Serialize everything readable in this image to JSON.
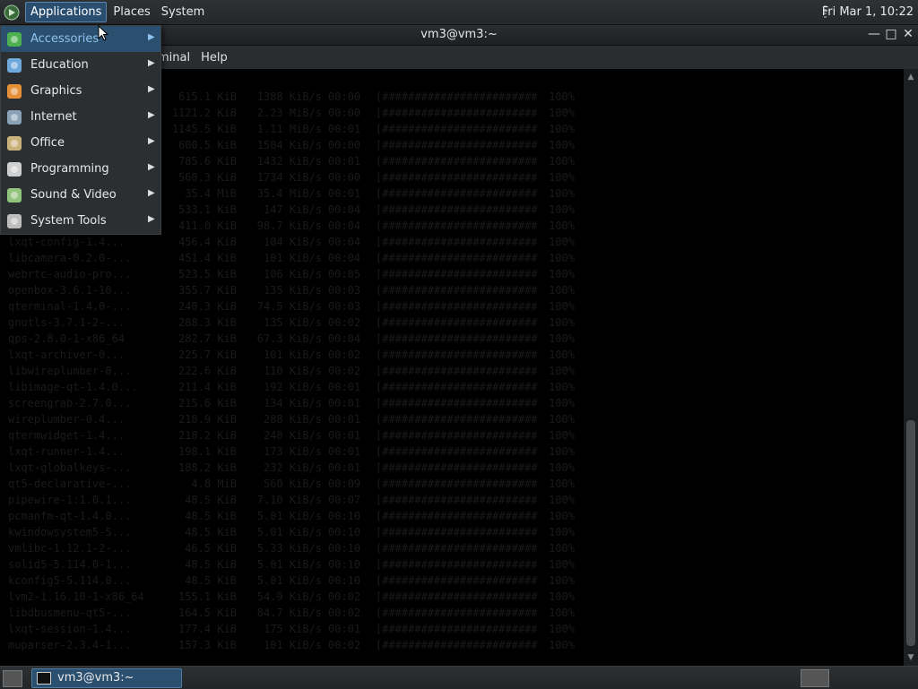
{
  "top_panel": {
    "menus": [
      "Applications",
      "Places",
      "System"
    ],
    "clock": "Fri Mar 1, 10:22"
  },
  "terminal": {
    "title": "vm3@vm3:~",
    "menus": [
      "minal",
      "Help"
    ],
    "lines": [
      {
        "name": "",
        "size": "615.1 KiB",
        "speed": "1388 KiB/s",
        "time": "00:00",
        "pct": "100%"
      },
      {
        "name": "",
        "size": "1121.2 KiB",
        "speed": "2.23 MiB/s",
        "time": "00:00",
        "pct": "100%"
      },
      {
        "name": "",
        "size": "1145.5 KiB",
        "speed": "1.11 MiB/s",
        "time": "00:01",
        "pct": "100%"
      },
      {
        "name": "",
        "size": "600.5 KiB",
        "speed": "1504 KiB/s",
        "time": "00:00",
        "pct": "100%"
      },
      {
        "name": "",
        "size": "785.6 KiB",
        "speed": "1432 KiB/s",
        "time": "00:01",
        "pct": "100%"
      },
      {
        "name": "",
        "size": "560.3 KiB",
        "speed": "1734 KiB/s",
        "time": "00:00",
        "pct": "100%"
      },
      {
        "name": "",
        "size": "35.4 MiB",
        "speed": "35.4 MiB/s",
        "time": "00:01",
        "pct": "100%"
      },
      {
        "name": "",
        "size": "533.1 KiB",
        "speed": "147 KiB/s",
        "time": "00:04",
        "pct": "100%"
      },
      {
        "name": "",
        "size": "411.0 KiB",
        "speed": "98.7 KiB/s",
        "time": "00:04",
        "pct": "100%"
      },
      {
        "name": "lxqt-config-1.4...",
        "size": "456.4 KiB",
        "speed": "104 KiB/s",
        "time": "00:04",
        "pct": "100%"
      },
      {
        "name": "libcamera-0.2.0-...",
        "size": "451.4 KiB",
        "speed": "101 KiB/s",
        "time": "00:04",
        "pct": "100%"
      },
      {
        "name": "webrtc-audio-pro...",
        "size": "523.5 KiB",
        "speed": "106 KiB/s",
        "time": "00:05",
        "pct": "100%"
      },
      {
        "name": "openbox-3.6.1-10...",
        "size": "355.7 KiB",
        "speed": "135 KiB/s",
        "time": "00:03",
        "pct": "100%"
      },
      {
        "name": "qterminal-1.4.0-...",
        "size": "240.3 KiB",
        "speed": "74.5 KiB/s",
        "time": "00:03",
        "pct": "100%"
      },
      {
        "name": "gnutls-3.7.1-2-...",
        "size": "288.3 KiB",
        "speed": "135 KiB/s",
        "time": "00:02",
        "pct": "100%"
      },
      {
        "name": "qps-2.8.0-1-x86_64",
        "size": "282.7 KiB",
        "speed": "67.3 KiB/s",
        "time": "00:04",
        "pct": "100%"
      },
      {
        "name": "lxqt-archiver-0...",
        "size": "225.7 KiB",
        "speed": "101 KiB/s",
        "time": "00:02",
        "pct": "100%"
      },
      {
        "name": "libwireplumber-0...",
        "size": "222.6 KiB",
        "speed": "110 KiB/s",
        "time": "00:02",
        "pct": "100%"
      },
      {
        "name": "libimage-qt-1.4.0...",
        "size": "211.4 KiB",
        "speed": "192 KiB/s",
        "time": "00:01",
        "pct": "100%"
      },
      {
        "name": "screengrab-2.7.0...",
        "size": "215.6 KiB",
        "speed": "134 KiB/s",
        "time": "00:01",
        "pct": "100%"
      },
      {
        "name": "wireplumber-0.4...",
        "size": "218.9 KiB",
        "speed": "288 KiB/s",
        "time": "00:01",
        "pct": "100%"
      },
      {
        "name": "qtermwidget-1.4...",
        "size": "218.2 KiB",
        "speed": "248 KiB/s",
        "time": "00:01",
        "pct": "100%"
      },
      {
        "name": "lxqt-runner-1.4...",
        "size": "198.1 KiB",
        "speed": "173 KiB/s",
        "time": "00:01",
        "pct": "100%"
      },
      {
        "name": "lxqt-globalkeys-...",
        "size": "188.2 KiB",
        "speed": "232 KiB/s",
        "time": "00:01",
        "pct": "100%"
      },
      {
        "name": "qt5-declarative-...",
        "size": "4.8 MiB",
        "speed": "560 KiB/s",
        "time": "00:09",
        "pct": "100%"
      },
      {
        "name": "pipewire-1:1.0.1...",
        "size": "48.5 KiB",
        "speed": "7.10 KiB/s",
        "time": "00:07",
        "pct": "100%"
      },
      {
        "name": "pcmanfm-qt-1.4.0...",
        "size": "48.5 KiB",
        "speed": "5.01 KiB/s",
        "time": "00:10",
        "pct": "100%"
      },
      {
        "name": "kwindowsystem5-5...",
        "size": "48.5 KiB",
        "speed": "5.01 KiB/s",
        "time": "00:10",
        "pct": "100%"
      },
      {
        "name": "vmlibc-1.12.1-2-...",
        "size": "46.5 KiB",
        "speed": "5.33 KiB/s",
        "time": "00:10",
        "pct": "100%"
      },
      {
        "name": "solid5-5.114.0-1...",
        "size": "48.5 KiB",
        "speed": "5.01 KiB/s",
        "time": "00:10",
        "pct": "100%"
      },
      {
        "name": "kconfig5-5.114.0...",
        "size": "48.5 KiB",
        "speed": "5.01 KiB/s",
        "time": "00:10",
        "pct": "100%"
      },
      {
        "name": "lvm2-1.16.10-1-x86_64",
        "size": "155.1 KiB",
        "speed": "54.9 KiB/s",
        "time": "00:02",
        "pct": "100%"
      },
      {
        "name": "libdbusmenu-qt5-...",
        "size": "164.5 KiB",
        "speed": "84.7 KiB/s",
        "time": "00:02",
        "pct": "100%"
      },
      {
        "name": "lxqt-session-1.4...",
        "size": "177.4 KiB",
        "speed": "175 KiB/s",
        "time": "00:01",
        "pct": "100%"
      },
      {
        "name": "muparser-2.3.4-1...",
        "size": "157.3 KiB",
        "speed": "101 KiB/s",
        "time": "00:02",
        "pct": "100%"
      }
    ]
  },
  "apps_menu": {
    "items": [
      {
        "label": "Accessories",
        "icon": "accessories-icon",
        "color": "#4caf50"
      },
      {
        "label": "Education",
        "icon": "education-icon",
        "color": "#6fa8dc"
      },
      {
        "label": "Graphics",
        "icon": "graphics-icon",
        "color": "#e69138"
      },
      {
        "label": "Internet",
        "icon": "internet-icon",
        "color": "#8aa2b6"
      },
      {
        "label": "Office",
        "icon": "office-icon",
        "color": "#c9b27a"
      },
      {
        "label": "Programming",
        "icon": "programming-icon",
        "color": "#cfcfcf"
      },
      {
        "label": "Sound & Video",
        "icon": "sound-video-icon",
        "color": "#93c47d"
      },
      {
        "label": "System Tools",
        "icon": "system-tools-icon",
        "color": "#bdbdbd"
      }
    ]
  },
  "taskbar": {
    "window_label": "vm3@vm3:~"
  },
  "colors": {
    "accent": "#2b4f6f",
    "menu_highlight_text": "#8fc2ee"
  }
}
